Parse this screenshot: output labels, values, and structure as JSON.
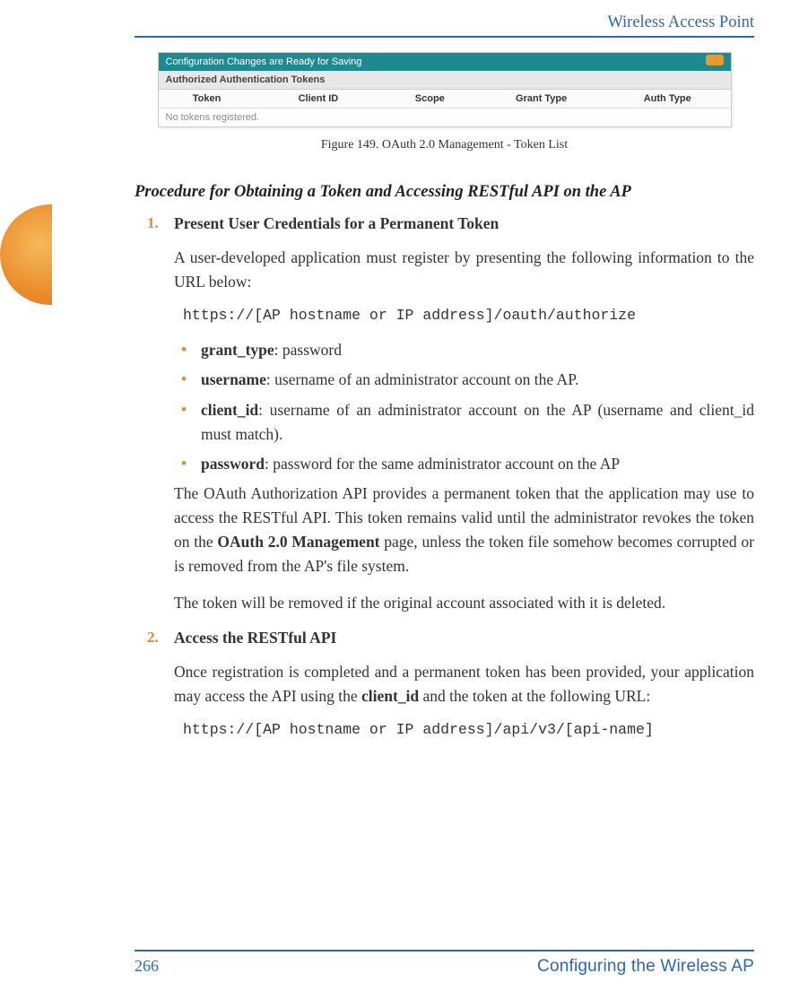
{
  "header": {
    "title": "Wireless Access Point"
  },
  "figure": {
    "banner": "Configuration Changes are Ready for Saving",
    "subheader": "Authorized Authentication Tokens",
    "columns": [
      "Token",
      "Client ID",
      "Scope",
      "Grant Type",
      "Auth Type"
    ],
    "empty_text": "No tokens registered.",
    "caption": "Figure 149. OAuth 2.0 Management - Token List"
  },
  "procedure_title": "Procedure for Obtaining a Token and Accessing RESTful API on the AP",
  "steps": [
    {
      "num": "1.",
      "title": "Present User Credentials for a Permanent Token",
      "para1": "A user-developed application must register by presenting the following information to the URL below:",
      "code": "https://[AP hostname or IP address]/oauth/authorize",
      "bullets": [
        {
          "label": "grant_type",
          "rest": ": password"
        },
        {
          "label": "username",
          "rest": ": username of an administrator account on the AP."
        },
        {
          "label": "client_id",
          "rest": ": username of an administrator account on the AP (username and client_id must match)."
        },
        {
          "label": "password",
          "rest": ": password for the same administrator account on the AP"
        }
      ],
      "para2a": "The OAuth Authorization API provides a permanent token that the application may use to access the RESTful API.   This token remains valid until the administrator revokes the token on the ",
      "para2_bold": "OAuth 2.0 Management",
      "para2b": " page, unless the token file somehow becomes corrupted or is removed from the AP's file system.",
      "para3": "The token will be removed if the original account associated with it is deleted."
    },
    {
      "num": "2.",
      "title": "Access the RESTful API",
      "para1a": "Once registration is completed and a permanent token has been provided, your application may access the API using the ",
      "para1_bold": "client_id",
      "para1b": " and the token at the following URL:",
      "code": "https://[AP hostname or IP address]/api/v3/[api-name]"
    }
  ],
  "footer": {
    "page_number": "266",
    "section": "Configuring the Wireless AP"
  }
}
